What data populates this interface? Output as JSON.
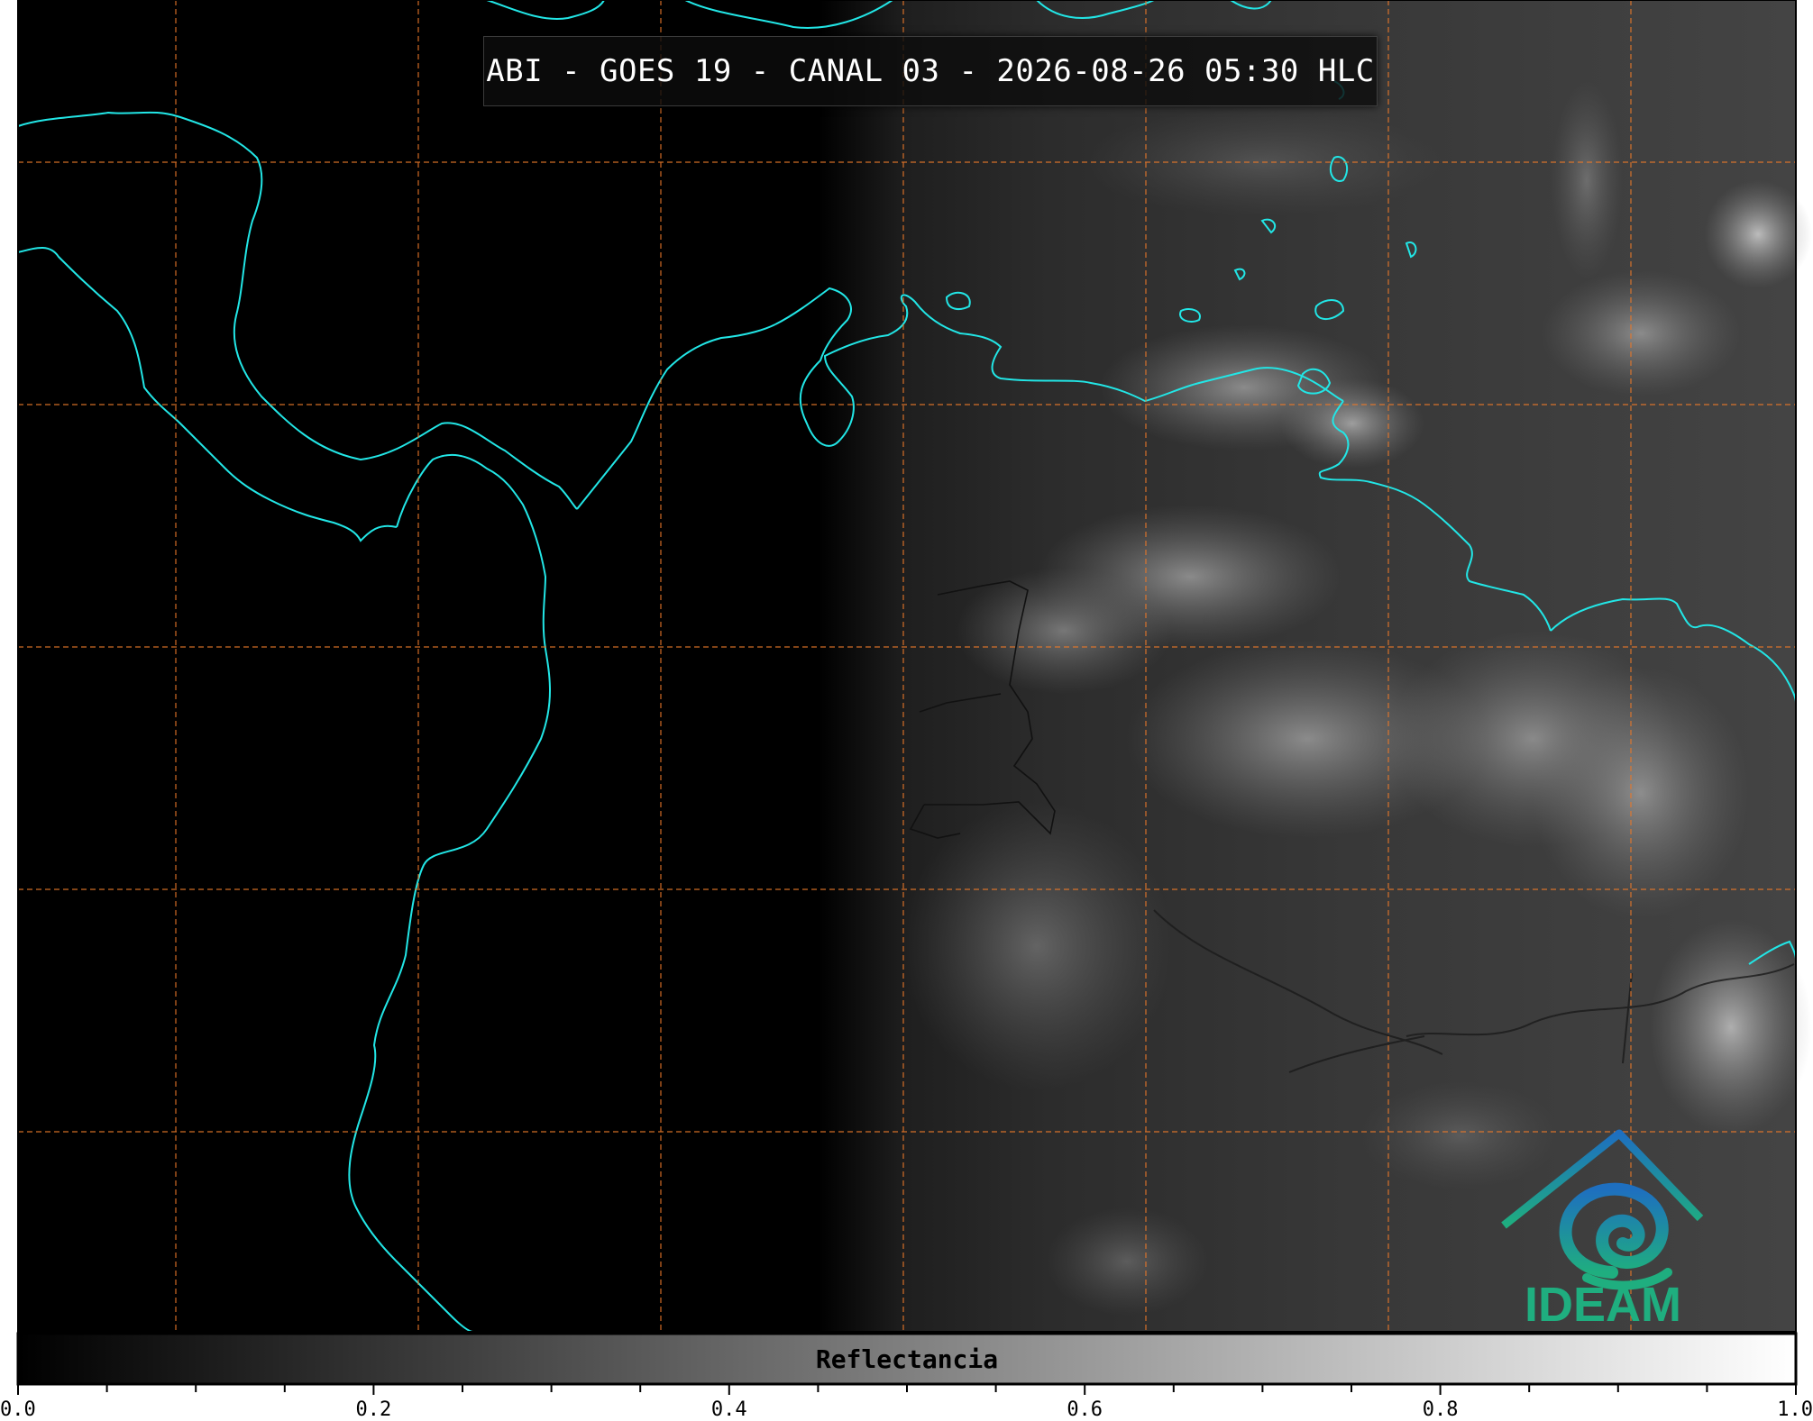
{
  "title": "ABI - GOES 19 - CANAL 03 - 2026-08-26 05:30 HLC",
  "colorbar": {
    "label": "Reflectancia",
    "ticks": [
      "0.0",
      "0.2",
      "0.4",
      "0.6",
      "0.8",
      "1.0"
    ],
    "range": [
      0.0,
      1.0
    ],
    "colormap": "greys"
  },
  "logo": {
    "text": "IDEAM"
  },
  "colors": {
    "coastline": "#22e6e6",
    "gridline": "#e8782a",
    "night": "#000000",
    "logo_text": "#1fae7f",
    "logo_blue": "#1e6fc0"
  }
}
